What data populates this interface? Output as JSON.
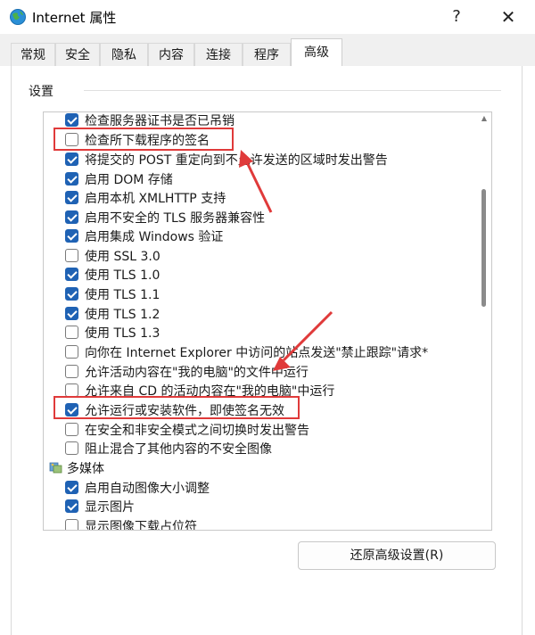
{
  "window": {
    "title": "Internet 属性",
    "help_label": "?",
    "close_label": "✕"
  },
  "tabs": [
    {
      "label": "常规",
      "active": false
    },
    {
      "label": "安全",
      "active": false
    },
    {
      "label": "隐私",
      "active": false
    },
    {
      "label": "内容",
      "active": false
    },
    {
      "label": "连接",
      "active": false
    },
    {
      "label": "程序",
      "active": false
    },
    {
      "label": "高级",
      "active": true
    }
  ],
  "settings": {
    "group_label": "设置",
    "items": [
      {
        "label": "检查服务器证书是否已吊销",
        "checked": true
      },
      {
        "label": "检查所下载程序的签名",
        "checked": false
      },
      {
        "label": "将提交的 POST 重定向到不允许发送的区域时发出警告",
        "checked": true
      },
      {
        "label": "启用 DOM 存储",
        "checked": true
      },
      {
        "label": "启用本机 XMLHTTP 支持",
        "checked": true
      },
      {
        "label": "启用不安全的 TLS 服务器兼容性",
        "checked": true
      },
      {
        "label": "启用集成 Windows 验证",
        "checked": true
      },
      {
        "label": "使用 SSL 3.0",
        "checked": false
      },
      {
        "label": "使用 TLS 1.0",
        "checked": true
      },
      {
        "label": "使用 TLS 1.1",
        "checked": true
      },
      {
        "label": "使用 TLS 1.2",
        "checked": true
      },
      {
        "label": "使用 TLS 1.3",
        "checked": false
      },
      {
        "label": "向你在 Internet Explorer 中访问的站点发送\"禁止跟踪\"请求*",
        "checked": false
      },
      {
        "label": "允许活动内容在\"我的电脑\"的文件中运行",
        "checked": false
      },
      {
        "label": "允许来自 CD 的活动内容在\"我的电脑\"中运行",
        "checked": false
      },
      {
        "label": "允许运行或安装软件，即使签名无效",
        "checked": true
      },
      {
        "label": "在安全和非安全模式之间切换时发出警告",
        "checked": false
      },
      {
        "label": "阻止混合了其他内容的不安全图像",
        "checked": false
      }
    ],
    "section": {
      "label": "多媒体",
      "icon": "multimedia-icon"
    },
    "media_items": [
      {
        "label": "启用自动图像大小调整",
        "checked": true
      },
      {
        "label": "显示图片",
        "checked": true
      },
      {
        "label": "显示图像下载占位符",
        "checked": false
      }
    ]
  },
  "restore_button": {
    "label": "还原高级设置(R)"
  },
  "colors": {
    "checkbox_accent": "#1f62b4",
    "highlight": "#e03a3a"
  }
}
